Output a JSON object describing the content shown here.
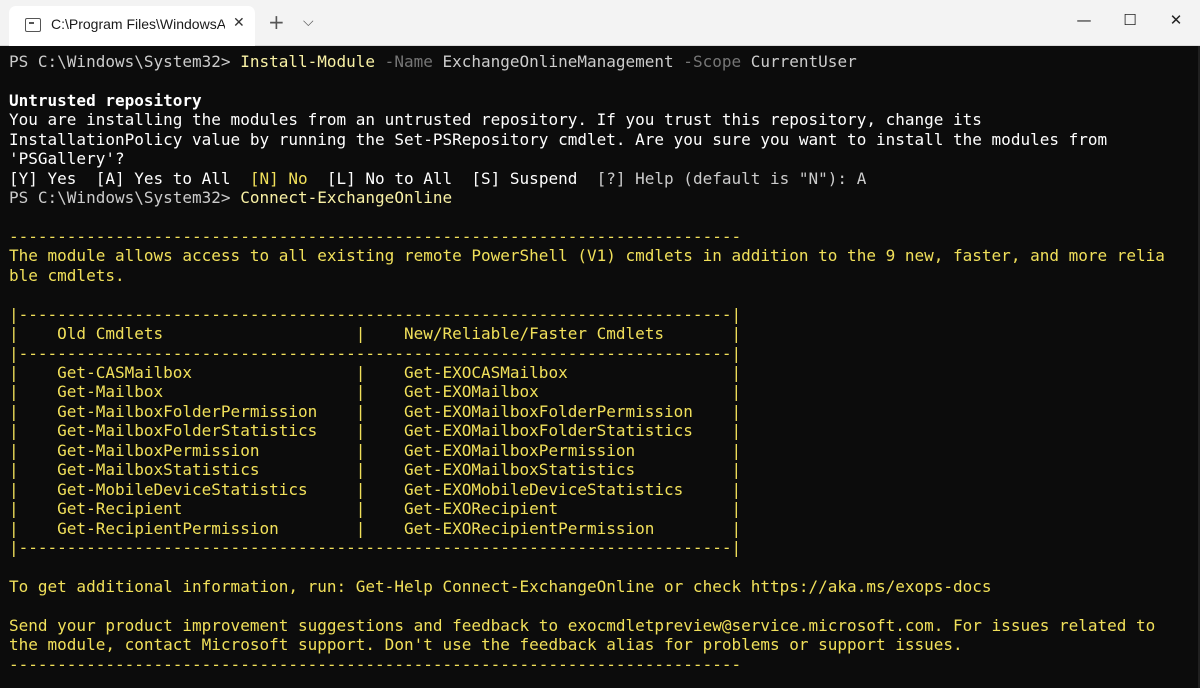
{
  "window": {
    "tab_title": "C:\\Program Files\\WindowsApps\\Microsoft.WindowsTerminal",
    "tab_close": "✕",
    "new_tab": "+",
    "dropdown": "⌵",
    "minimize": "—",
    "maximize": "☐",
    "close": "✕"
  },
  "terminal": {
    "prompt1": "PS C:\\Windows\\System32> ",
    "cmd1": "Install-Module",
    "param1": " -Name",
    "arg1": " ExchangeOnlineManagement",
    "param2": " -Scope",
    "arg2": " CurrentUser",
    "untrusted_title": "Untrusted repository",
    "untrusted_l1": "You are installing the modules from an untrusted repository. If you trust this repository, change its",
    "untrusted_l2": "InstallationPolicy value by running the Set-PSRepository cmdlet. Are you sure you want to install the modules from",
    "untrusted_l3": "'PSGallery'?",
    "opt_y": "[Y] Yes  [A] Yes to All  ",
    "opt_n": "[N] No",
    "opt_rest": "  [L] No to All  [S] Suspend  ",
    "opt_help": "[?] Help (default is \"N\"): A",
    "prompt2": "PS C:\\Windows\\System32> ",
    "cmd2": "Connect-ExchangeOnline",
    "dash_line": "----------------------------------------------------------------------------",
    "module_l1": "The module allows access to all existing remote PowerShell (V1) cmdlets in addition to the 9 new, faster, and more relia",
    "module_l2": "ble cmdlets.",
    "table_top": "|--------------------------------------------------------------------------|",
    "table_header": "|    Old Cmdlets                    |    New/Reliable/Faster Cmdlets       |",
    "table_sep": "|--------------------------------------------------------------------------|",
    "table_rows": [
      "|    Get-CASMailbox                 |    Get-EXOCASMailbox                 |",
      "|    Get-Mailbox                    |    Get-EXOMailbox                    |",
      "|    Get-MailboxFolderPermission    |    Get-EXOMailboxFolderPermission    |",
      "|    Get-MailboxFolderStatistics    |    Get-EXOMailboxFolderStatistics    |",
      "|    Get-MailboxPermission          |    Get-EXOMailboxPermission          |",
      "|    Get-MailboxStatistics          |    Get-EXOMailboxStatistics          |",
      "|    Get-MobileDeviceStatistics     |    Get-EXOMobileDeviceStatistics     |",
      "|    Get-Recipient                  |    Get-EXORecipient                  |",
      "|    Get-RecipientPermission        |    Get-EXORecipientPermission        |"
    ],
    "table_bottom": "|--------------------------------------------------------------------------|",
    "info_line": "To get additional information, run: Get-Help Connect-ExchangeOnline or check https://aka.ms/exops-docs",
    "feedback_l1": "Send your product improvement suggestions and feedback to exocmdletpreview@service.microsoft.com. For issues related to",
    "feedback_l2": "the module, contact Microsoft support. Don't use the feedback alias for problems or support issues.",
    "dash_line_end": "----------------------------------------------------------------------------"
  }
}
